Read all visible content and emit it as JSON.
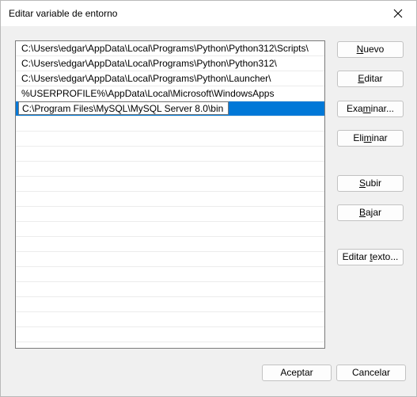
{
  "dialog": {
    "title": "Editar variable de entorno"
  },
  "entries": [
    "C:\\Users\\edgar\\AppData\\Local\\Programs\\Python\\Python312\\Scripts\\",
    "C:\\Users\\edgar\\AppData\\Local\\Programs\\Python\\Python312\\",
    "C:\\Users\\edgar\\AppData\\Local\\Programs\\Python\\Launcher\\",
    "%USERPROFILE%\\AppData\\Local\\Microsoft\\WindowsApps"
  ],
  "editing_entry": "C:\\Program Files\\MySQL\\MySQL Server 8.0\\bin",
  "buttons": {
    "nuevo": {
      "pre": "",
      "key": "N",
      "post": "uevo"
    },
    "editar": {
      "pre": "",
      "key": "E",
      "post": "ditar"
    },
    "examinar": {
      "pre": "Exa",
      "key": "m",
      "post": "inar..."
    },
    "eliminar": {
      "pre": "Eli",
      "key": "m",
      "post": "inar"
    },
    "subir": {
      "pre": "",
      "key": "S",
      "post": "ubir"
    },
    "bajar": {
      "pre": "",
      "key": "B",
      "post": "ajar"
    },
    "editar_texto": {
      "pre": "Editar ",
      "key": "t",
      "post": "exto..."
    },
    "aceptar": "Aceptar",
    "cancelar": "Cancelar"
  },
  "colors": {
    "selection": "#0078d7",
    "window_bg": "#f0f0f0"
  }
}
